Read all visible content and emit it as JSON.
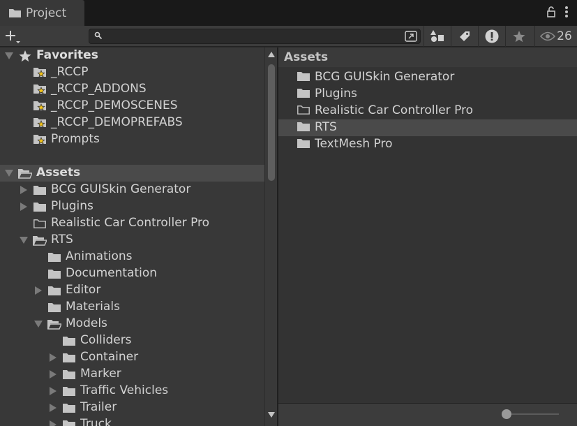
{
  "tab": {
    "title": "Project"
  },
  "toolbar": {
    "search_value": "",
    "hidden_count": "26"
  },
  "tree": [
    {
      "label": "Favorites",
      "depth": 0,
      "arrow": "open",
      "icon": "star",
      "bold": true,
      "selected": false
    },
    {
      "label": "_RCCP",
      "depth": 1,
      "arrow": "none",
      "icon": "fav-folder",
      "bold": false,
      "selected": false
    },
    {
      "label": "_RCCP_ADDONS",
      "depth": 1,
      "arrow": "none",
      "icon": "fav-folder",
      "bold": false,
      "selected": false
    },
    {
      "label": "_RCCP_DEMOSCENES",
      "depth": 1,
      "arrow": "none",
      "icon": "fav-folder",
      "bold": false,
      "selected": false
    },
    {
      "label": "_RCCP_DEMOPREFABS",
      "depth": 1,
      "arrow": "none",
      "icon": "fav-folder",
      "bold": false,
      "selected": false
    },
    {
      "label": "Prompts",
      "depth": 1,
      "arrow": "none",
      "icon": "fav-folder",
      "bold": false,
      "selected": false
    },
    {
      "label": "",
      "depth": 0,
      "arrow": "none",
      "icon": "none",
      "bold": false,
      "selected": false
    },
    {
      "label": "Assets",
      "depth": 0,
      "arrow": "open",
      "icon": "folder-open",
      "bold": true,
      "selected": true
    },
    {
      "label": "BCG GUISkin Generator",
      "depth": 1,
      "arrow": "closed",
      "icon": "folder",
      "bold": false,
      "selected": false
    },
    {
      "label": "Plugins",
      "depth": 1,
      "arrow": "closed",
      "icon": "folder",
      "bold": false,
      "selected": false
    },
    {
      "label": "Realistic Car Controller Pro",
      "depth": 1,
      "arrow": "none",
      "icon": "folder-empty",
      "bold": false,
      "selected": false
    },
    {
      "label": "RTS",
      "depth": 1,
      "arrow": "open",
      "icon": "folder-open",
      "bold": false,
      "selected": false
    },
    {
      "label": "Animations",
      "depth": 2,
      "arrow": "none",
      "icon": "folder",
      "bold": false,
      "selected": false
    },
    {
      "label": "Documentation",
      "depth": 2,
      "arrow": "none",
      "icon": "folder",
      "bold": false,
      "selected": false
    },
    {
      "label": "Editor",
      "depth": 2,
      "arrow": "closed",
      "icon": "folder",
      "bold": false,
      "selected": false
    },
    {
      "label": "Materials",
      "depth": 2,
      "arrow": "none",
      "icon": "folder",
      "bold": false,
      "selected": false
    },
    {
      "label": "Models",
      "depth": 2,
      "arrow": "open",
      "icon": "folder-open",
      "bold": false,
      "selected": false
    },
    {
      "label": "Colliders",
      "depth": 3,
      "arrow": "none",
      "icon": "folder",
      "bold": false,
      "selected": false
    },
    {
      "label": "Container",
      "depth": 3,
      "arrow": "closed",
      "icon": "folder",
      "bold": false,
      "selected": false
    },
    {
      "label": "Marker",
      "depth": 3,
      "arrow": "closed",
      "icon": "folder",
      "bold": false,
      "selected": false
    },
    {
      "label": "Traffic Vehicles",
      "depth": 3,
      "arrow": "closed",
      "icon": "folder",
      "bold": false,
      "selected": false
    },
    {
      "label": "Trailer",
      "depth": 3,
      "arrow": "closed",
      "icon": "folder",
      "bold": false,
      "selected": false
    },
    {
      "label": "Truck",
      "depth": 3,
      "arrow": "closed",
      "icon": "folder",
      "bold": false,
      "selected": false
    }
  ],
  "content": {
    "header": "Assets",
    "items": [
      {
        "label": "BCG GUISkin Generator",
        "icon": "folder",
        "selected": false
      },
      {
        "label": "Plugins",
        "icon": "folder",
        "selected": false
      },
      {
        "label": "Realistic Car Controller Pro",
        "icon": "folder-empty",
        "selected": false
      },
      {
        "label": "RTS",
        "icon": "folder",
        "selected": true
      },
      {
        "label": "TextMesh Pro",
        "icon": "folder",
        "selected": false
      }
    ]
  },
  "footer": {
    "zoom_level": 0
  },
  "colors": {
    "background": "#282828",
    "panel": "#383838",
    "selected": "#4a4a4a",
    "favorite_star": "#f5c518",
    "text": "#d2d2d2"
  }
}
